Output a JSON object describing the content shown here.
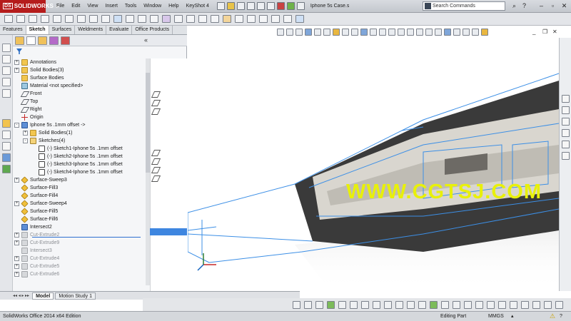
{
  "app": {
    "brand": "SOLIDWORKS",
    "brand_mark": "DS",
    "document_title": "Iphone 5s Case.sl...",
    "search_placeholder": "Search Commands"
  },
  "menu": [
    "File",
    "Edit",
    "View",
    "Insert",
    "Tools",
    "Window",
    "Help",
    "KeyShot 4"
  ],
  "command_tabs": [
    "Features",
    "Sketch",
    "Surfaces",
    "Weldments",
    "Evaluate",
    "Office Products"
  ],
  "active_command_tab": "Sketch",
  "tree": [
    {
      "label": "Annotations",
      "icon": "annotation-icon",
      "expander": "+",
      "state": "normal"
    },
    {
      "label": "Solid Bodies(3)",
      "icon": "solid-bodies-icon",
      "expander": "+",
      "state": "normal"
    },
    {
      "label": "Surface Bodies",
      "icon": "surface-bodies-icon",
      "expander": "",
      "state": "normal"
    },
    {
      "label": "Material <not specified>",
      "icon": "material-icon",
      "expander": "",
      "state": "normal"
    },
    {
      "label": "Front",
      "icon": "plane-icon",
      "expander": "",
      "state": "normal"
    },
    {
      "label": "Top",
      "icon": "plane-icon",
      "expander": "",
      "state": "normal"
    },
    {
      "label": "Right",
      "icon": "plane-icon",
      "expander": "",
      "state": "normal"
    },
    {
      "label": "Origin",
      "icon": "origin-icon",
      "expander": "",
      "state": "normal"
    },
    {
      "label": "Iphone 5s .1mm offset ->",
      "icon": "part-icon",
      "expander": "-",
      "state": "normal"
    },
    {
      "label": "Solid Bodies(1)",
      "icon": "solid-bodies-icon",
      "expander": "+",
      "state": "normal"
    },
    {
      "label": "Sketches(4)",
      "icon": "folder-icon",
      "expander": "-",
      "state": "normal"
    },
    {
      "label": "(-) Sketch1-Iphone 5s .1mm offset",
      "icon": "sketch-icon",
      "expander": "",
      "state": "normal"
    },
    {
      "label": "(-) Sketch2-Iphone 5s .1mm offset",
      "icon": "sketch-icon",
      "expander": "",
      "state": "normal"
    },
    {
      "label": "(-) Sketch3-Iphone 5s .1mm offset",
      "icon": "sketch-icon",
      "expander": "",
      "state": "normal"
    },
    {
      "label": "(-) Sketch4-Iphone 5s .1mm offset",
      "icon": "sketch-icon",
      "expander": "",
      "state": "normal"
    },
    {
      "label": "Surface-Sweep3",
      "icon": "surface-sweep-icon",
      "expander": "+",
      "state": "normal"
    },
    {
      "label": "Surface-Fill3",
      "icon": "surface-fill-icon",
      "expander": "",
      "state": "normal"
    },
    {
      "label": "Surface-Fill4",
      "icon": "surface-fill-icon",
      "expander": "",
      "state": "normal"
    },
    {
      "label": "Surface-Sweep4",
      "icon": "surface-sweep-icon",
      "expander": "+",
      "state": "normal"
    },
    {
      "label": "Surface-Fill5",
      "icon": "surface-fill-icon",
      "expander": "",
      "state": "normal"
    },
    {
      "label": "Surface-Fill6",
      "icon": "surface-fill-icon",
      "expander": "",
      "state": "normal"
    },
    {
      "label": "Intersect2",
      "icon": "intersect-icon",
      "expander": "",
      "state": "selected"
    },
    {
      "label": "Cut-Extrude2",
      "icon": "cut-extrude-icon",
      "expander": "+",
      "state": "suppressed"
    },
    {
      "label": "Cut-Extrude9",
      "icon": "cut-extrude-icon",
      "expander": "+",
      "state": "suppressed"
    },
    {
      "label": "Intersect3",
      "icon": "intersect-icon",
      "expander": "",
      "state": "suppressed"
    },
    {
      "label": "Cut-Extrude4",
      "icon": "cut-extrude-icon",
      "expander": "+",
      "state": "suppressed"
    },
    {
      "label": "Cut-Extrude5",
      "icon": "cut-extrude-icon",
      "expander": "+",
      "state": "suppressed"
    },
    {
      "label": "Cut-Extrude6",
      "icon": "cut-extrude-icon",
      "expander": "+",
      "state": "suppressed"
    }
  ],
  "viewport": {
    "watermark": "WWW.CGTSJ.COM",
    "body_color": "#3a3a3a",
    "inner_color": "#d9d6cf",
    "wire_color": "#3c8fe6"
  },
  "bottom_tabs": [
    "Model",
    "Motion Study 1"
  ],
  "active_bottom_tab": "Model",
  "status": {
    "edition": "SolidWorks Office 2014 x64 Edition",
    "mode": "Editing Part",
    "units": "MMGS"
  },
  "colors": {
    "brand_red": "#b51c1c",
    "selection_blue": "#3e86e0",
    "watermark_yellow": "#e8f00a"
  }
}
